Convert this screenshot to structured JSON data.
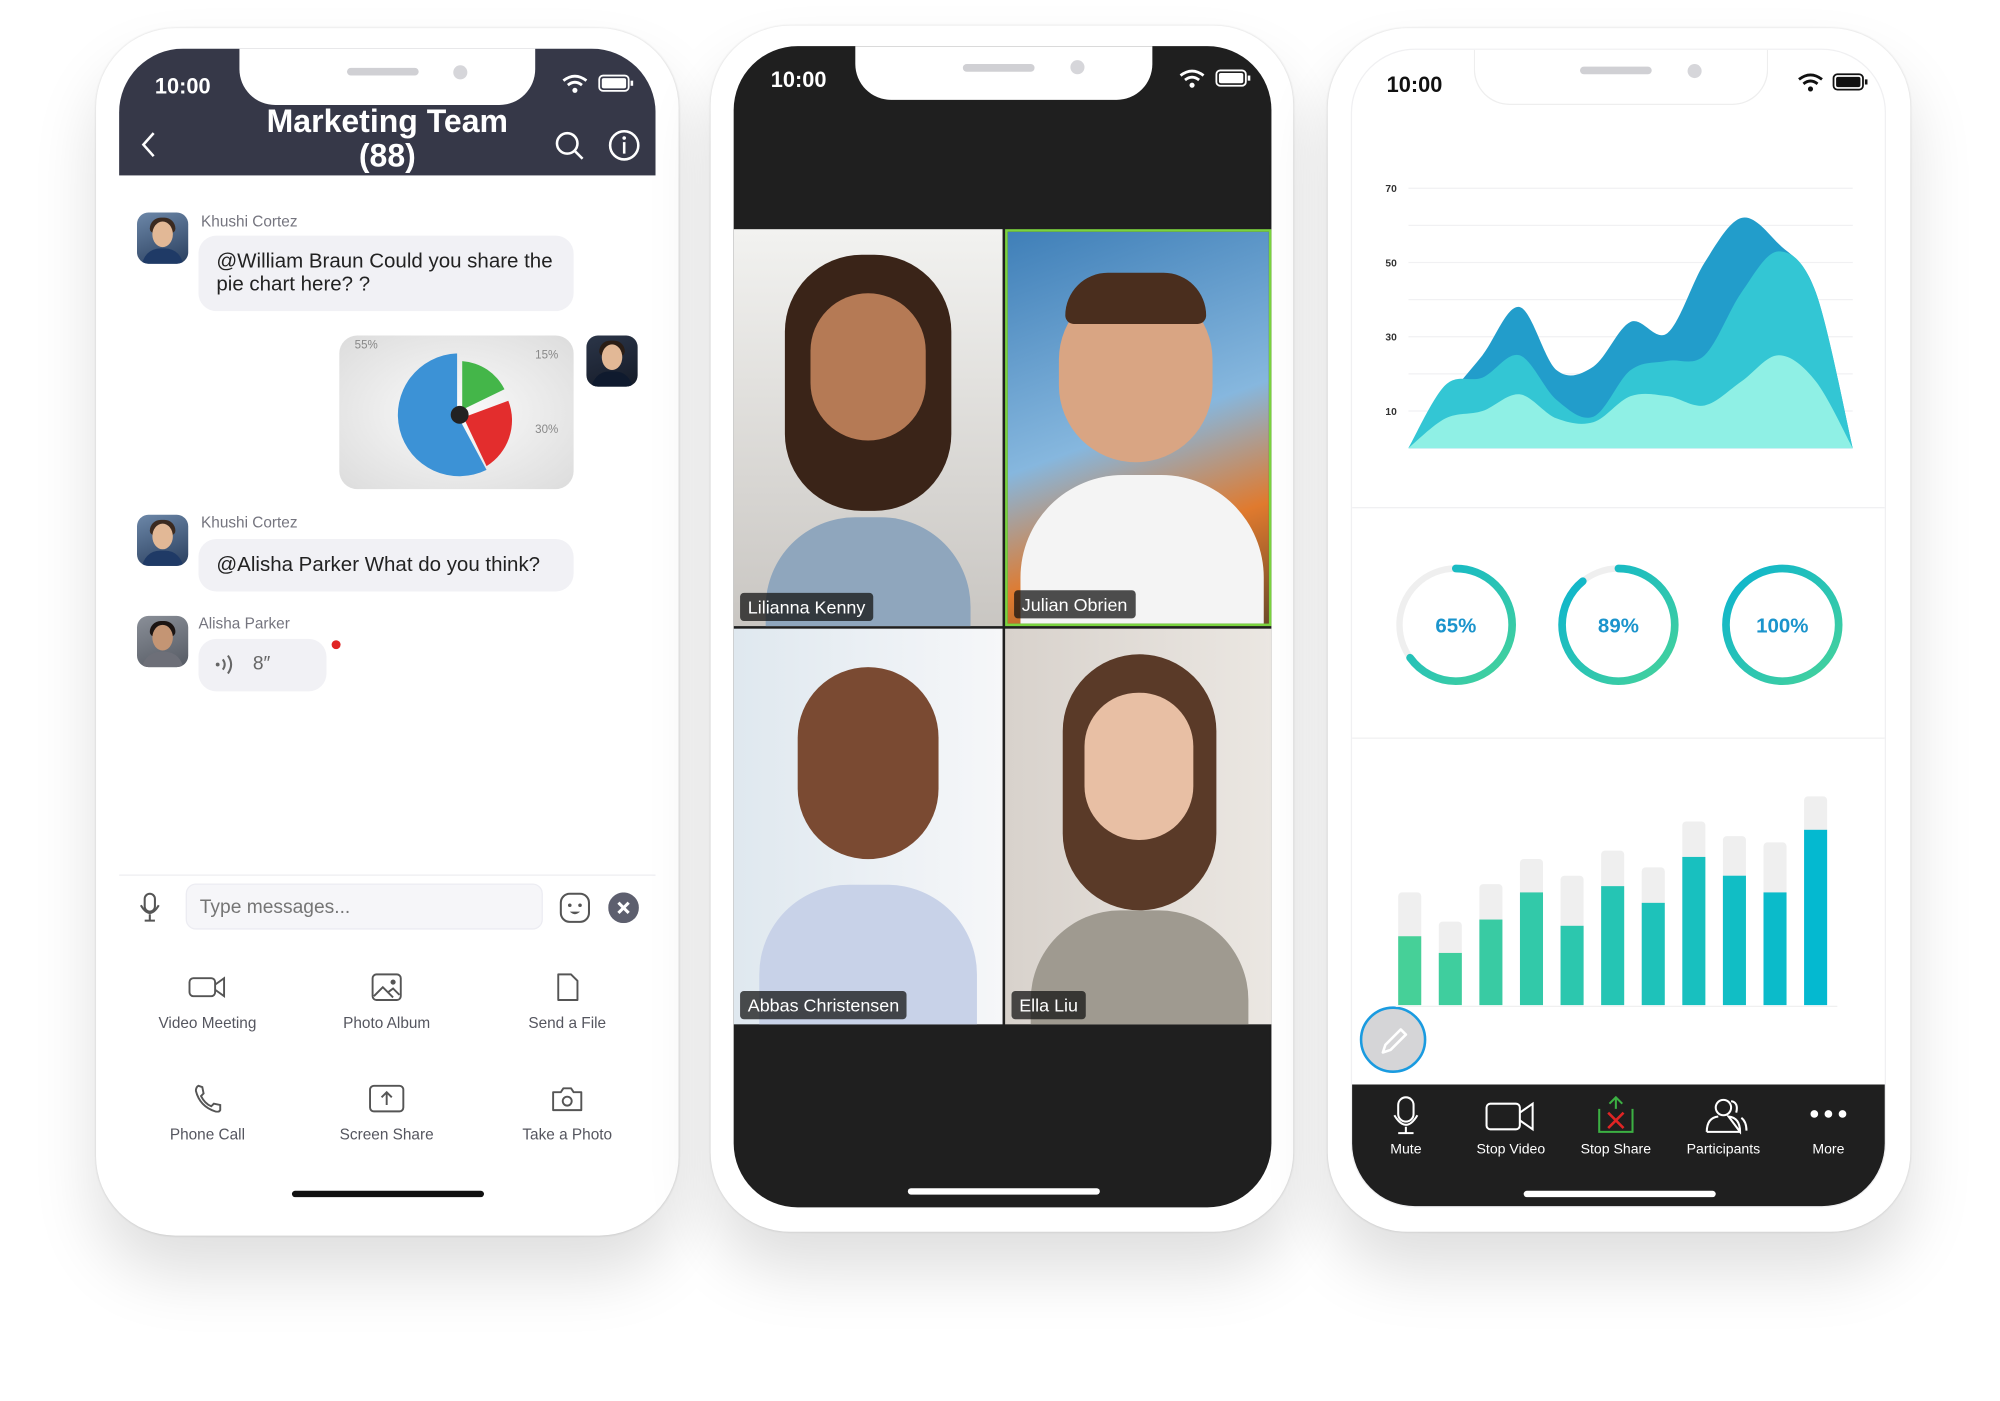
{
  "phones": {
    "chat": {
      "status_time": "10:00",
      "header": {
        "title": "Marketing Team",
        "count": "(88)"
      },
      "messages": [
        {
          "sender": "Khushi Cortez",
          "text": "@William Braun Could you share the pie chart here? ?"
        },
        {
          "sender": "",
          "type": "image",
          "pie_labels": [
            "55%",
            "15%",
            "30%"
          ]
        },
        {
          "sender": "Khushi Cortez",
          "text": "@Alisha Parker What do you think?"
        },
        {
          "sender": "Alisha Parker",
          "type": "voice",
          "duration": "8″",
          "unread": true
        }
      ],
      "composer": {
        "placeholder": "Type messages..."
      },
      "actions": [
        {
          "label": "Video Meeting",
          "icon": "video-camera-icon"
        },
        {
          "label": "Photo Album",
          "icon": "image-icon"
        },
        {
          "label": "Send a File",
          "icon": "file-icon"
        },
        {
          "label": "Phone Call",
          "icon": "phone-icon"
        },
        {
          "label": "Screen Share",
          "icon": "screen-share-icon"
        },
        {
          "label": "Take a Photo",
          "icon": "camera-icon"
        }
      ]
    },
    "video": {
      "status_time": "10:00",
      "participants": [
        {
          "name": "Lilianna Kenny",
          "active": false
        },
        {
          "name": "Julian Obrien",
          "active": true
        },
        {
          "name": "Abbas Christensen",
          "active": false
        },
        {
          "name": "Ella Liu",
          "active": false
        }
      ],
      "active_speaker_color": "#7bd33f"
    },
    "share": {
      "status_time": "10:00",
      "gauges": [
        65,
        89,
        100
      ],
      "gauge_labels": [
        "65%",
        "89%",
        "100%"
      ],
      "toolbar": [
        {
          "label": "Mute",
          "icon": "microphone-icon"
        },
        {
          "label": "Stop Video",
          "icon": "video-camera-icon"
        },
        {
          "label": "Stop Share",
          "icon": "stop-share-icon"
        },
        {
          "label": "Participants",
          "icon": "participants-icon"
        },
        {
          "label": "More",
          "icon": "more-dots-icon"
        }
      ]
    }
  },
  "chart_data": [
    {
      "type": "area",
      "yticks": [
        "10",
        "30",
        "50",
        "70"
      ],
      "ylim": [
        0,
        70
      ],
      "grid": true,
      "x": [
        0,
        1,
        2,
        3,
        4,
        5,
        6,
        7,
        8,
        9,
        10,
        11,
        12
      ],
      "series": [
        {
          "values": [
            0,
            13,
            25,
            38,
            21,
            22,
            34,
            31,
            50,
            62,
            55,
            42,
            0
          ],
          "color": "#229dcb"
        },
        {
          "values": [
            0,
            17,
            19,
            25,
            13,
            8.5,
            21,
            23.5,
            25,
            42,
            53,
            42,
            0
          ],
          "color": "#33c6d4"
        },
        {
          "values": [
            0,
            8,
            10,
            14.5,
            8,
            7,
            14,
            14,
            11.5,
            18,
            25,
            18,
            0
          ],
          "color": "#8ff0e5"
        }
      ]
    },
    {
      "type": "bar",
      "stacked_background": true,
      "values": [
        33,
        25,
        41,
        54,
        38,
        57,
        49,
        71,
        62,
        54,
        84
      ],
      "totals": [
        54,
        40,
        58,
        70,
        62,
        74,
        66,
        88,
        81,
        78,
        100
      ]
    }
  ]
}
